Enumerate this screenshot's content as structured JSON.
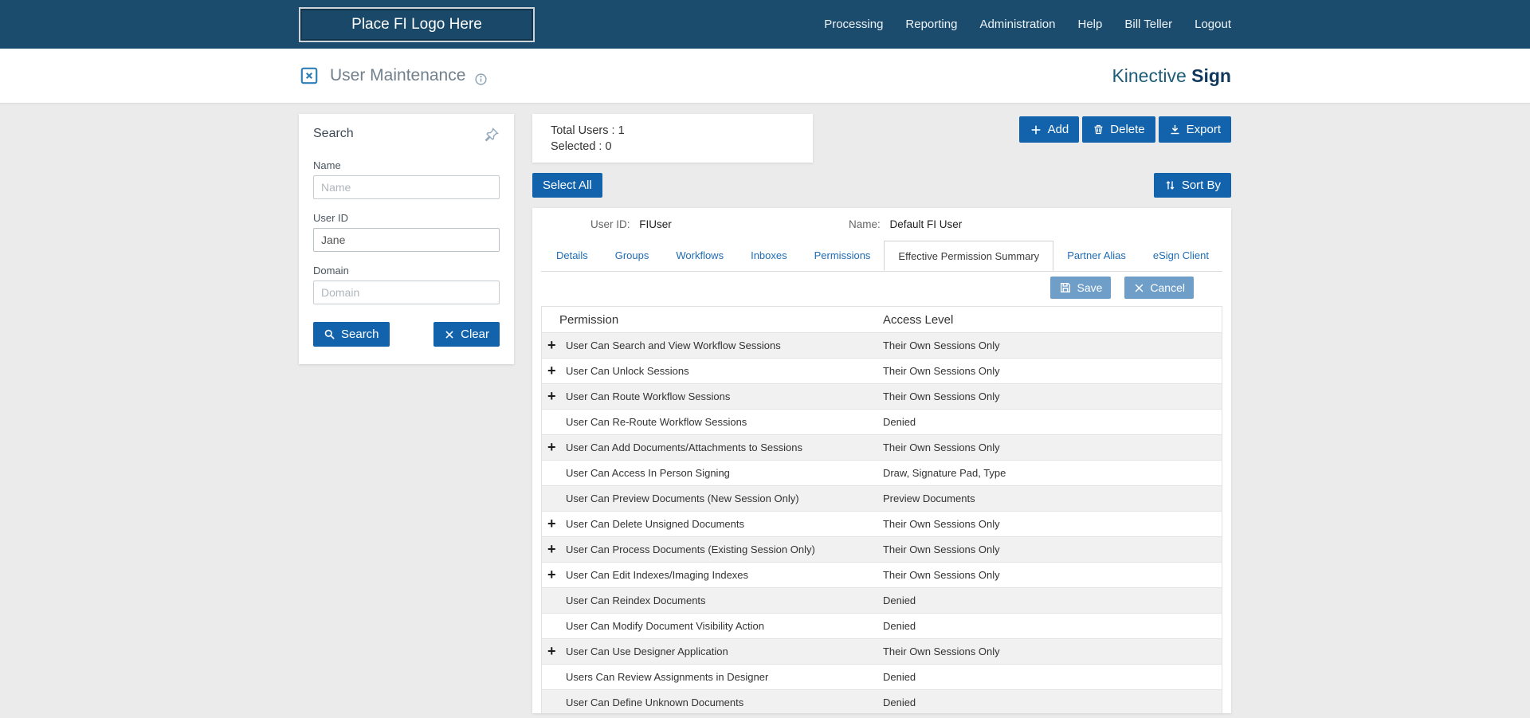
{
  "topnav": {
    "logo_placeholder": "Place FI Logo Here",
    "items": [
      "Processing",
      "Reporting",
      "Administration",
      "Help",
      "Bill Teller",
      "Logout"
    ]
  },
  "header": {
    "title": "User Maintenance",
    "brand_first": "Kinective",
    "brand_second": "Sign"
  },
  "search_panel": {
    "title": "Search",
    "name_label": "Name",
    "name_placeholder": "Name",
    "userid_label": "User ID",
    "userid_value": "Jane",
    "domain_label": "Domain",
    "domain_placeholder": "Domain",
    "search_button": "Search",
    "clear_button": "Clear"
  },
  "summary": {
    "total_users": "Total Users : 1",
    "selected": "Selected : 0"
  },
  "toolbar": {
    "add": "Add",
    "delete": "Delete",
    "export": "Export",
    "select_all": "Select All",
    "sort_by": "Sort By"
  },
  "user_panel": {
    "user_id_label": "User ID:",
    "user_id_value": "FIUser",
    "name_label": "Name:",
    "name_value": "Default FI User",
    "tabs": [
      {
        "label": "Details",
        "active": false
      },
      {
        "label": "Groups",
        "active": false
      },
      {
        "label": "Workflows",
        "active": false
      },
      {
        "label": "Inboxes",
        "active": false
      },
      {
        "label": "Permissions",
        "active": false
      },
      {
        "label": "Effective Permission Summary",
        "active": true
      },
      {
        "label": "Partner Alias",
        "active": false
      },
      {
        "label": "eSign Client",
        "active": false
      }
    ],
    "save": "Save",
    "cancel": "Cancel"
  },
  "permissions_table": {
    "col_permission": "Permission",
    "col_access": "Access Level",
    "rows": [
      {
        "expandable": true,
        "permission": "User Can Search and View Workflow Sessions",
        "access": "Their Own Sessions Only"
      },
      {
        "expandable": true,
        "permission": "User Can Unlock Sessions",
        "access": "Their Own Sessions Only"
      },
      {
        "expandable": true,
        "permission": "User Can Route Workflow Sessions",
        "access": "Their Own Sessions Only"
      },
      {
        "expandable": false,
        "permission": "User Can Re-Route Workflow Sessions",
        "access": "Denied"
      },
      {
        "expandable": true,
        "permission": "User Can Add Documents/Attachments to Sessions",
        "access": "Their Own Sessions Only"
      },
      {
        "expandable": false,
        "permission": "User Can Access In Person Signing",
        "access": "Draw, Signature Pad, Type"
      },
      {
        "expandable": false,
        "permission": "User Can Preview Documents (New Session Only)",
        "access": "Preview Documents"
      },
      {
        "expandable": true,
        "permission": "User Can Delete Unsigned Documents",
        "access": "Their Own Sessions Only"
      },
      {
        "expandable": true,
        "permission": "User Can Process Documents (Existing Session Only)",
        "access": "Their Own Sessions Only"
      },
      {
        "expandable": true,
        "permission": "User Can Edit Indexes/Imaging Indexes",
        "access": "Their Own Sessions Only"
      },
      {
        "expandable": false,
        "permission": "User Can Reindex Documents",
        "access": "Denied"
      },
      {
        "expandable": false,
        "permission": "User Can Modify Document Visibility Action",
        "access": "Denied"
      },
      {
        "expandable": true,
        "permission": "User Can Use Designer Application",
        "access": "Their Own Sessions Only"
      },
      {
        "expandable": false,
        "permission": "Users Can Review Assignments in Designer",
        "access": "Denied"
      },
      {
        "expandable": false,
        "permission": "User Can Define Unknown Documents",
        "access": "Denied"
      }
    ]
  },
  "colors": {
    "topbar": "#1b4c6e",
    "accent_blue": "#1363ac",
    "light_blue_button": "#6f9fc9",
    "tab_link_blue": "#1f6cb4",
    "row_alt_gray": "#f1f1f1",
    "page_background": "#ebebeb"
  }
}
